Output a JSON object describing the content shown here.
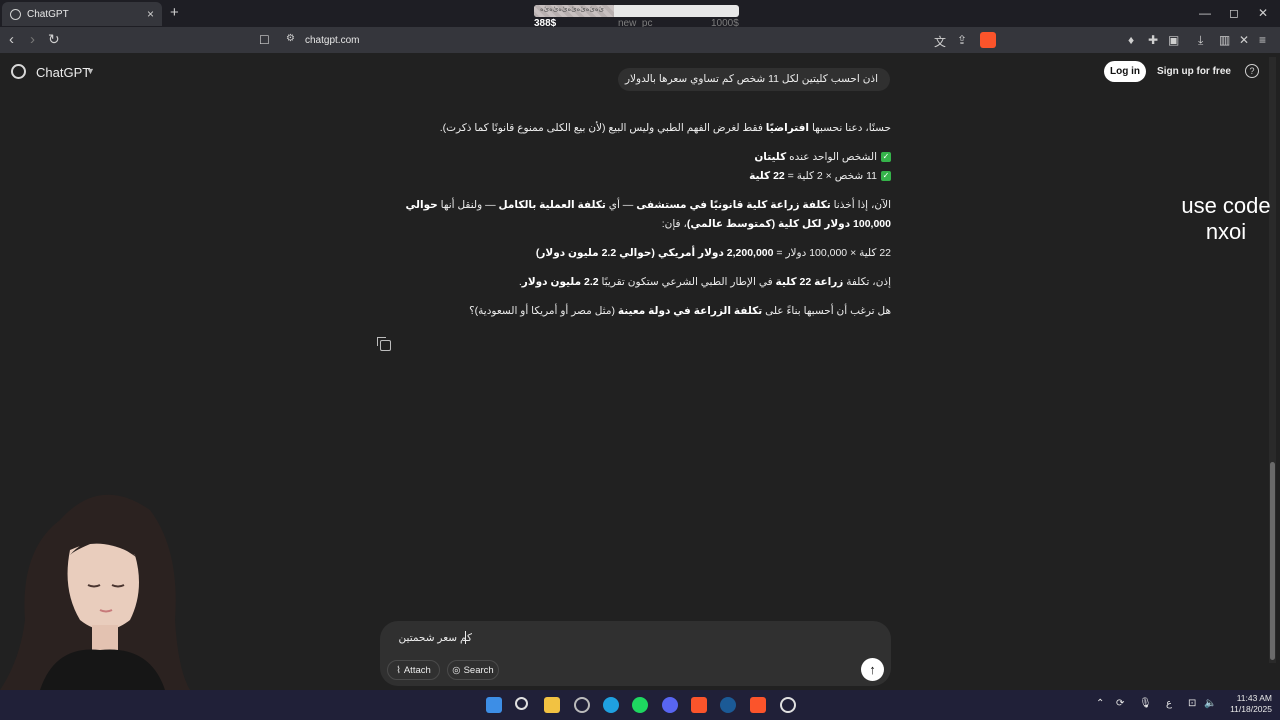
{
  "browser": {
    "tab_title": "ChatGPT",
    "tab_close": "×",
    "new_tab": "+",
    "url": "chatgpt.com",
    "window_min": "—",
    "window_max": "◻",
    "window_close": "✕"
  },
  "stream_overlay": {
    "bar_text": "ئ‌ه‌‌‌ئ‌ه‌ئ‌ه‌ئ‌ه‌ئ‌ه‌ئ‌ه‌ئ‌ه‌",
    "left_amount": "388$",
    "mid_label": "new_pc",
    "right_amount": "1000$",
    "progress": 0.39
  },
  "header": {
    "brand": "ChatGPT",
    "login": "Log in",
    "signup": "Sign up for free",
    "help": "?"
  },
  "chat": {
    "user_message": "اذن احسب كليتين لكل 11 شخص كم تساوي سعرها بالدولار",
    "assistant": {
      "p1_a": "حسنًا، دعنا نحسبها ",
      "p1_b": "افتراضيًا",
      "p1_c": " فقط لغرض الفهم الطبي وليس البيع (لأن بيع الكلى ممنوع قانونًا كما ذكرت).",
      "c1_a": "الشخص الواحد عنده ",
      "c1_b": "كليتان",
      "c2_a": "11 شخص × 2 كلية = ",
      "c2_b": "22 كلية",
      "p2_a": "الآن، إذا أخذنا ",
      "p2_b": "تكلفة زراعة كلية قانونيًا في مستشفى",
      "p2_c": " — أي ",
      "p2_d": "تكلفة العملية بالكامل",
      "p2_e": " — ولنقل أنها ",
      "p2_f": "حوالي 100,000 دولار لكل كلية (كمتوسط عالمي)",
      "p2_g": "، فإن:",
      "p3_a": "22 كلية × 100,000 دولار = ",
      "p3_b": "2,200,000 دولار أمريكي (حوالي 2.2 مليون دولار)",
      "p4_a": "إذن، تكلفة ",
      "p4_b": "زراعة 22 كلية",
      "p4_c": " في الإطار الطبي الشرعي ستكون تقريبًا ",
      "p4_d": "2.2 مليون دولار",
      "p4_e": ".",
      "p5_a": "هل ترغب أن أحسبها بناءً على ",
      "p5_b": "تكلفة الزراعة في دولة معينة",
      "p5_c": " (مثل مصر أو أمريكا أو السعودية)؟"
    }
  },
  "promo": {
    "line1": "use code",
    "line2": "nxoi"
  },
  "composer": {
    "input_value": "كم سعر شحمتين",
    "attach": "Attach",
    "search": "Search"
  },
  "taskbar": {
    "time": "11:43 AM",
    "date": "11/18/2025",
    "lang": "ع"
  },
  "colors": {
    "background": "#212121",
    "composer": "#303030",
    "brave": "#fb542b",
    "check": "#35b34a"
  }
}
